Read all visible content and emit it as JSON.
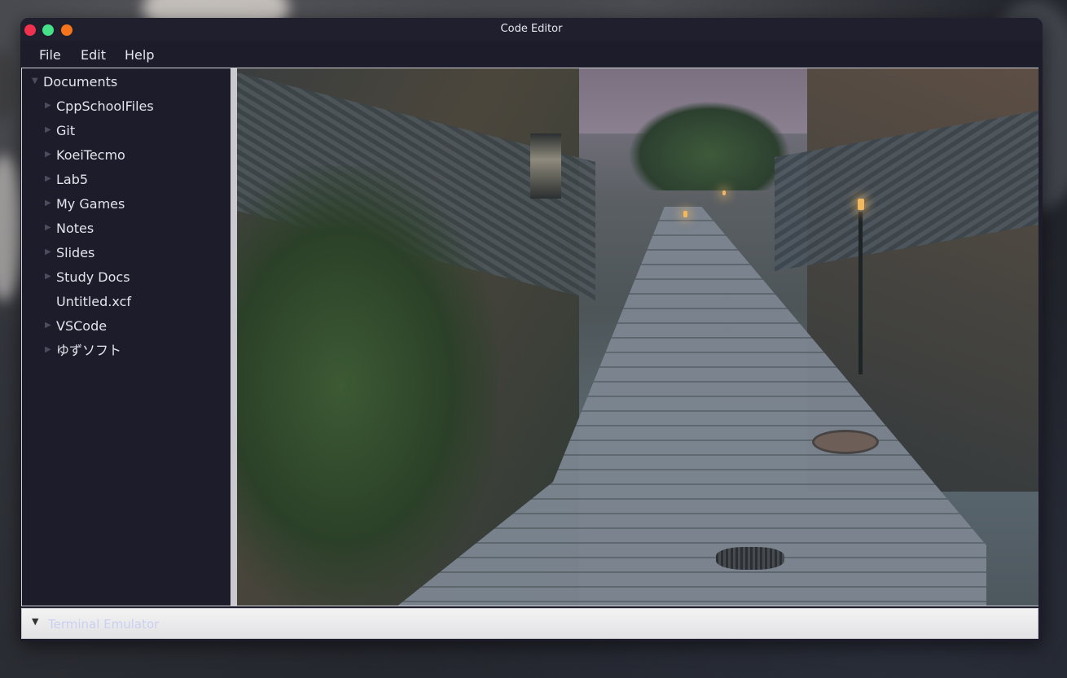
{
  "window": {
    "title": "Code Editor"
  },
  "menubar": {
    "items": [
      "File",
      "Edit",
      "Help"
    ]
  },
  "file_tree": {
    "root": {
      "label": "Documents",
      "expanded": true
    },
    "items": [
      {
        "label": "CppSchoolFiles",
        "has_children": true
      },
      {
        "label": "Git",
        "has_children": true
      },
      {
        "label": "KoeiTecmo",
        "has_children": true
      },
      {
        "label": "Lab5",
        "has_children": true
      },
      {
        "label": "My Games",
        "has_children": true
      },
      {
        "label": "Notes",
        "has_children": true
      },
      {
        "label": "Slides",
        "has_children": true
      },
      {
        "label": "Study Docs",
        "has_children": true
      },
      {
        "label": "Untitled.xcf",
        "has_children": false
      },
      {
        "label": "VSCode",
        "has_children": true
      },
      {
        "label": "ゆずソフト",
        "has_children": true
      }
    ]
  },
  "terminal": {
    "label": "Terminal Emulator",
    "expanded": true
  },
  "icons": {
    "expanded": "triangle-down-icon",
    "collapsed": "triangle-right-icon"
  },
  "colors": {
    "close": "#f0324e",
    "minimize": "#46e28a",
    "maximize": "#f5741c",
    "panel_bg": "#1c1c2b",
    "text": "#e4e4ec"
  }
}
